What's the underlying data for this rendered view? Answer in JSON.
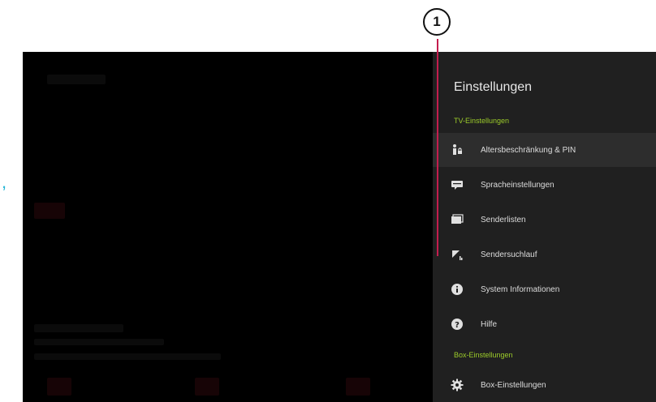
{
  "callout": {
    "number": "1"
  },
  "edge_mark": ",",
  "settings": {
    "title": "Einstellungen",
    "sections": [
      {
        "label": "TV-Einstellungen",
        "items": [
          {
            "label": "Altersbeschränkung & PIN",
            "icon": "parental-lock-icon",
            "active": true
          },
          {
            "label": "Spracheinstellungen",
            "icon": "language-icon",
            "active": false
          },
          {
            "label": "Senderlisten",
            "icon": "channel-list-icon",
            "active": false
          },
          {
            "label": "Sendersuchlauf",
            "icon": "channel-scan-icon",
            "active": false
          },
          {
            "label": "System Informationen",
            "icon": "info-icon",
            "active": false
          },
          {
            "label": "Hilfe",
            "icon": "help-icon",
            "active": false
          }
        ]
      },
      {
        "label": "Box-Einstellungen",
        "items": [
          {
            "label": "Box-Einstellungen",
            "icon": "gear-icon",
            "active": false
          }
        ]
      }
    ]
  },
  "colors": {
    "accent": "#9ccc2a",
    "callout_line": "#c41d4e",
    "panel": "#202020",
    "active_row": "#2d2d2d"
  }
}
